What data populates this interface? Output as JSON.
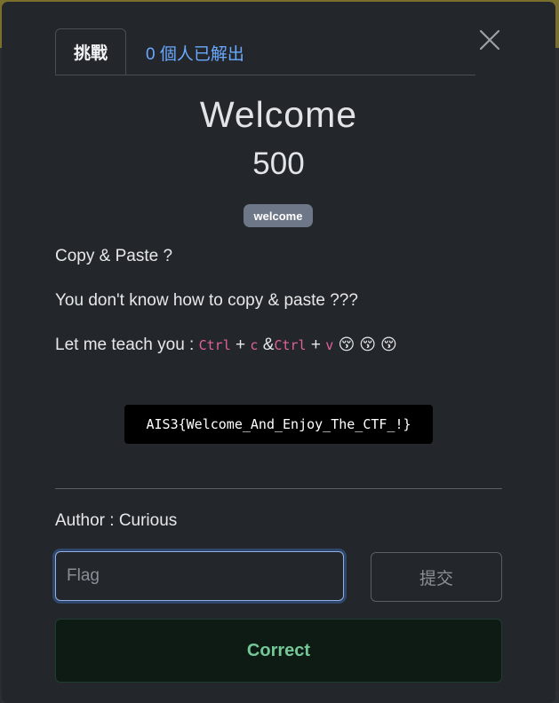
{
  "tabs": {
    "challenge_label": "挑戰",
    "solves_label": "0 個人已解出"
  },
  "close_icon": "close-icon",
  "challenge": {
    "title": "Welcome",
    "points": "500",
    "tag": "welcome"
  },
  "description": {
    "line1": "Copy & Paste ?",
    "line2": "You don't know how to copy & paste ???",
    "line3_prefix": "Let me teach you :",
    "key_ctrl_1": "Ctrl",
    "plus_1": "+",
    "key_c": "c",
    "amp": "&",
    "key_ctrl_2": "Ctrl",
    "plus_2": "+",
    "key_v": "v",
    "emojis": "😚 😚 😚"
  },
  "flag_code": "AIS3{Welcome_And_Enjoy_The_CTF_!}",
  "author": "Author : Curious",
  "form": {
    "flag_placeholder": "Flag",
    "flag_value": "",
    "submit_label": "提交"
  },
  "result": {
    "message": "Correct"
  },
  "colors": {
    "accent_link": "#6aa9ff",
    "tag_bg": "#6e7787",
    "success_text": "#74c796",
    "success_bg": "#0d1b14",
    "code_pink": "#e2619b"
  }
}
